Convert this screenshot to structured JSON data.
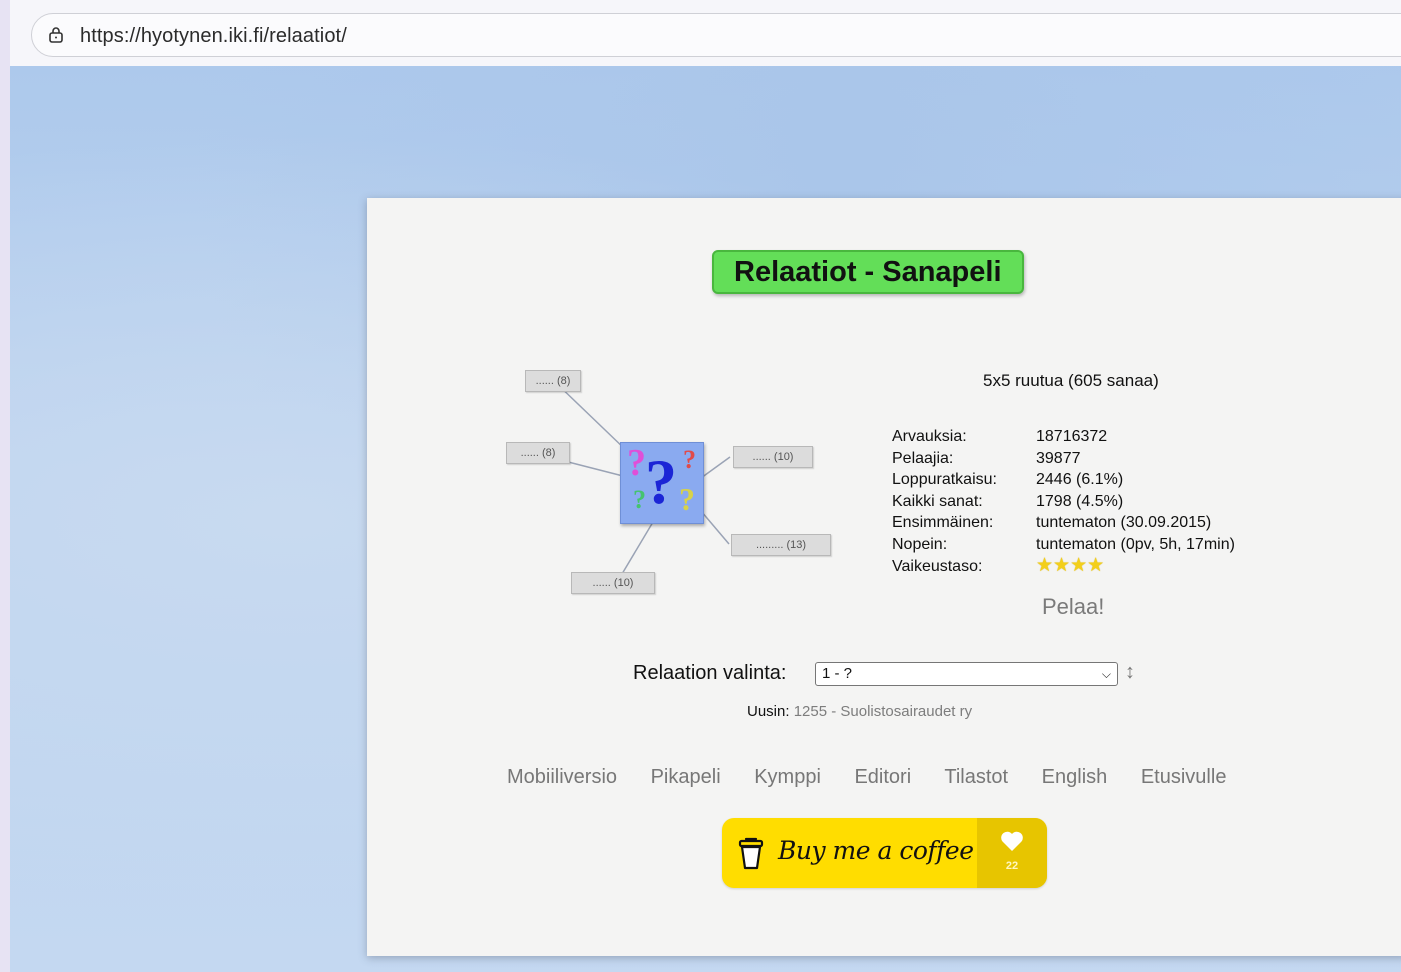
{
  "browser": {
    "url": "https://hyotynen.iki.fi/relaatiot/"
  },
  "page": {
    "title": "Relaatiot - Sanapeli",
    "diagram": {
      "nodes": [
        {
          "label": "...... (8)"
        },
        {
          "label": "...... (8)"
        },
        {
          "label": "...... (10)"
        },
        {
          "label": "......... (13)"
        },
        {
          "label": "...... (10)"
        }
      ]
    },
    "board_size": "5x5 ruutua (605 sanaa)",
    "stats": [
      {
        "label": "Arvauksia:",
        "value": "18716372"
      },
      {
        "label": "Pelaajia:",
        "value": "39877"
      },
      {
        "label": "Loppuratkaisu:",
        "value": "2446 (6.1%)"
      },
      {
        "label": "Kaikki sanat:",
        "value": "1798 (4.5%)"
      },
      {
        "label": "Ensimmäinen:",
        "value": "tuntematon (30.09.2015)"
      },
      {
        "label": "Nopein:",
        "value": "tuntematon (0pv, 5h, 17min)"
      },
      {
        "label": "Vaikeustaso:",
        "value": "★★★★"
      }
    ],
    "difficulty_stars": 4,
    "play_link": "Pelaa!",
    "relation_select": {
      "label": "Relaation valinta:",
      "selected": "1 - ?"
    },
    "newest": {
      "label": "Uusin:",
      "value": "1255 - Suolistosairaudet ry"
    },
    "nav": [
      "Mobiiliversio",
      "Pikapeli",
      "Kymppi",
      "Editori",
      "Tilastot",
      "English",
      "Etusivulle"
    ],
    "coffee": {
      "label": "Buy me a coffee",
      "count": "22",
      "color": "#ffdd00"
    }
  }
}
